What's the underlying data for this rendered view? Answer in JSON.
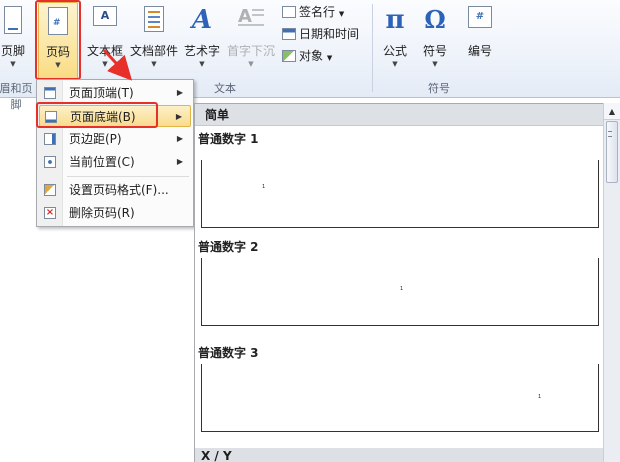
{
  "ribbon": {
    "footer_button": "页脚",
    "page_number_button": "页码",
    "textbox_button": "文本框",
    "quick_parts_button": "文档部件",
    "wordart_button": "艺术字",
    "dropcap_button": "首字下沉",
    "signature_line": "签名行",
    "date_time": "日期和时间",
    "object": "对象",
    "equation_button": "公式",
    "symbol_button": "符号",
    "number_button": "编号",
    "group_header_footer": "眉和页脚",
    "group_text": "文本",
    "group_symbols": "符号"
  },
  "menu": {
    "items": [
      {
        "label": "页面顶端(T)",
        "submenu": true
      },
      {
        "label": "页面底端(B)",
        "submenu": true
      },
      {
        "label": "页边距(P)",
        "submenu": true
      },
      {
        "label": "当前位置(C)",
        "submenu": true
      },
      {
        "label": "设置页码格式(F)..."
      },
      {
        "label": "删除页码(R)"
      }
    ]
  },
  "gallery": {
    "header": "简单",
    "options": [
      {
        "title": "普通数字 1",
        "sample": "1",
        "align": "left"
      },
      {
        "title": "普通数字 2",
        "sample": "1",
        "align": "center"
      },
      {
        "title": "普通数字 3",
        "sample": "1",
        "align": "right"
      }
    ],
    "footer": "X / Y"
  },
  "colors": {
    "highlight": "#e8302a",
    "menu_hot": "#f8dc8e"
  }
}
